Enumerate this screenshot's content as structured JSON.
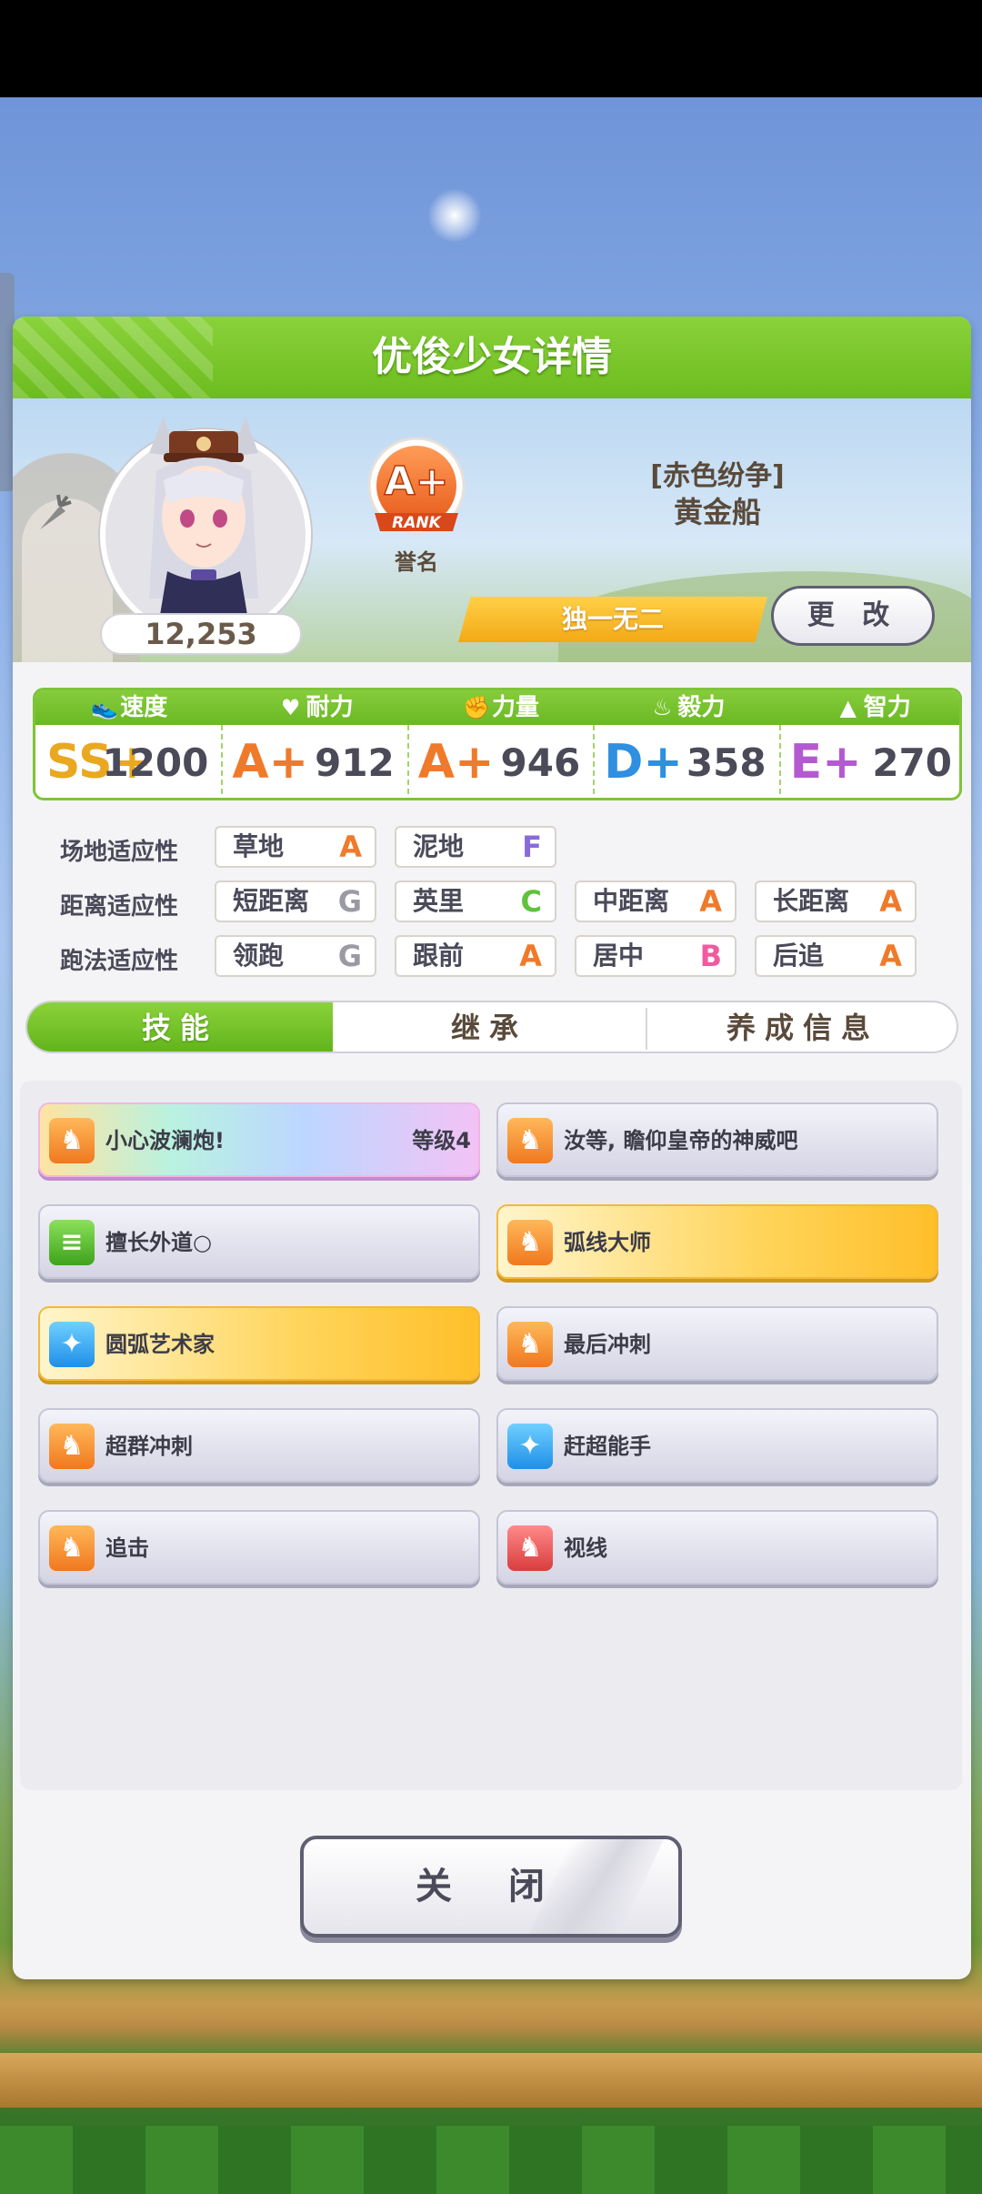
{
  "window": {
    "title": "优俊少女详情"
  },
  "profile": {
    "fans": "12,253",
    "rank_grade": "A+",
    "rank_word": "RANK",
    "rank_label": "誉名",
    "title": "[赤色纷争]",
    "name": "黄金船",
    "epithet": "独一无二",
    "change_button": "更 改"
  },
  "stats": [
    {
      "label": "速度",
      "icon": "shoe-icon",
      "grade": "SS+",
      "value": "1200",
      "color": "#e9a820"
    },
    {
      "label": "耐力",
      "icon": "heart-icon",
      "grade": "A+",
      "value": "912",
      "color": "#f07a2a"
    },
    {
      "label": "力量",
      "icon": "muscle-icon",
      "grade": "A+",
      "value": "946",
      "color": "#f07a2a"
    },
    {
      "label": "毅力",
      "icon": "flame-icon",
      "grade": "D+",
      "value": "358",
      "color": "#2f8fe0"
    },
    {
      "label": "智力",
      "icon": "graduation-cap-icon",
      "grade": "E+",
      "value": "270",
      "color": "#b45ad0"
    }
  ],
  "aptitudes": {
    "track": {
      "label": "场地适应性",
      "items": [
        {
          "name": "草地",
          "grade": "A"
        },
        {
          "name": "泥地",
          "grade": "F"
        }
      ]
    },
    "distance": {
      "label": "距离适应性",
      "items": [
        {
          "name": "短距离",
          "grade": "G"
        },
        {
          "name": "英里",
          "grade": "C"
        },
        {
          "name": "中距离",
          "grade": "A"
        },
        {
          "name": "长距离",
          "grade": "A"
        }
      ]
    },
    "style": {
      "label": "跑法适应性",
      "items": [
        {
          "name": "领跑",
          "grade": "G"
        },
        {
          "name": "跟前",
          "grade": "A"
        },
        {
          "name": "居中",
          "grade": "B"
        },
        {
          "name": "后追",
          "grade": "A"
        }
      ]
    }
  },
  "grade_colors": {
    "A": "#f07a2a",
    "B": "#f05aa0",
    "C": "#5ec23a",
    "F": "#8a6ad8",
    "G": "#9a9aa4"
  },
  "tabs": [
    {
      "label": "技能",
      "active": true
    },
    {
      "label": "继承",
      "active": false
    },
    {
      "label": "养成信息",
      "active": false
    }
  ],
  "skills": [
    {
      "name": "小心波澜炮!",
      "level": "等级4",
      "icon": "running-horse-icon",
      "style": "rainbow",
      "icon_color": "orange"
    },
    {
      "name": "汝等, 瞻仰皇帝的神威吧",
      "level": "",
      "icon": "running-horse-icon",
      "style": "plain",
      "icon_color": "orange"
    },
    {
      "name": "擅长外道○",
      "level": "",
      "icon": "document-icon",
      "style": "plain",
      "icon_color": "green"
    },
    {
      "name": "弧线大师",
      "level": "",
      "icon": "running-horse-icon",
      "style": "gold",
      "icon_color": "orange"
    },
    {
      "name": "圆弧艺术家",
      "level": "",
      "icon": "sparkle-icon",
      "style": "gold",
      "icon_color": "blue"
    },
    {
      "name": "最后冲刺",
      "level": "",
      "icon": "running-horse-icon",
      "style": "plain",
      "icon_color": "orange"
    },
    {
      "name": "超群冲刺",
      "level": "",
      "icon": "running-horse-icon",
      "style": "plain",
      "icon_color": "orange"
    },
    {
      "name": "赶超能手",
      "level": "",
      "icon": "sparkle-icon",
      "style": "plain",
      "icon_color": "blue"
    },
    {
      "name": "追击",
      "level": "",
      "icon": "running-horse-icon",
      "style": "plain",
      "icon_color": "orange"
    },
    {
      "name": "视线",
      "level": "",
      "icon": "horse-silhouette-icon",
      "style": "plain",
      "icon_color": "red"
    }
  ],
  "close_button": "关 闭"
}
